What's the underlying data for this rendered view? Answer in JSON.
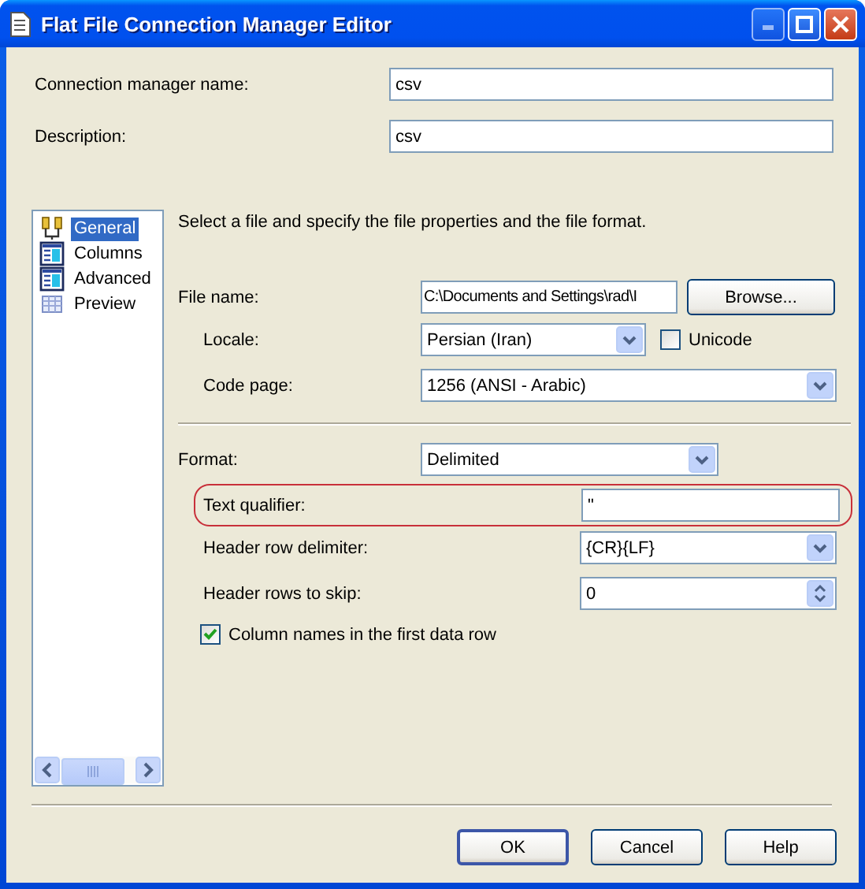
{
  "window": {
    "title": "Flat File Connection Manager Editor"
  },
  "general": [
    {
      "label": "Connection manager name:",
      "value": "csv"
    },
    {
      "label": "Description:",
      "value": "csv"
    }
  ],
  "sidebar": {
    "items": [
      {
        "label": "General",
        "kind": "plug",
        "selected": true
      },
      {
        "label": "Columns",
        "kind": "grid",
        "selected": false
      },
      {
        "label": "Advanced",
        "kind": "grid",
        "selected": false
      },
      {
        "label": "Preview",
        "kind": "sheet",
        "selected": false
      }
    ]
  },
  "instruction": "Select a file and specify the file properties and the file format.",
  "file_name": {
    "label": "File name:",
    "value": "C:\\Documents and Settings\\rad\\I",
    "button": "Browse..."
  },
  "locale": {
    "label": "Locale:",
    "value": "Persian (Iran)"
  },
  "unicode": {
    "label": "Unicode",
    "checked": false
  },
  "code_page": {
    "label": "Code page:",
    "value": "1256  (ANSI - Arabic)"
  },
  "format": {
    "label": "Format:",
    "value": "Delimited"
  },
  "text_qualifier": {
    "label": "Text qualifier:",
    "value": "\"",
    "highlighted": true
  },
  "header_row_delimiter": {
    "label": "Header row delimiter:",
    "value": "{CR}{LF}"
  },
  "header_rows_to_skip": {
    "label": "Header rows to skip:",
    "value": "0"
  },
  "column_names": {
    "label": "Column names in the first data row",
    "checked": true
  },
  "buttons": [
    {
      "label": "OK",
      "default": true
    },
    {
      "label": "Cancel",
      "default": false
    },
    {
      "label": "Help",
      "default": false
    }
  ]
}
